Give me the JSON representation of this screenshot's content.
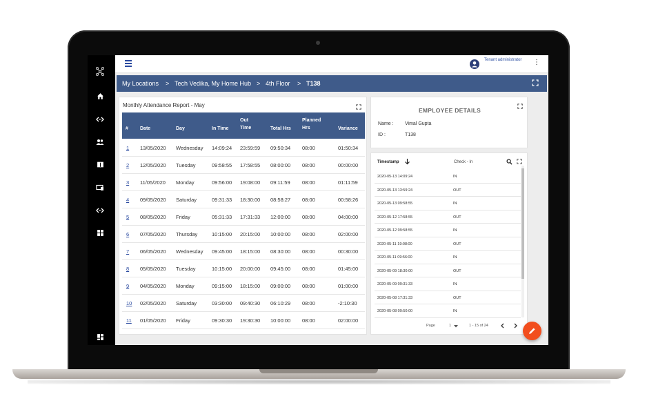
{
  "topbar": {
    "user_role": "Tenant administrator"
  },
  "breadcrumb": {
    "items": [
      "My Locations",
      ">",
      "Tech Vedika, My Home Hub",
      ">",
      "4th Floor",
      ">",
      "T138"
    ]
  },
  "attendance": {
    "title": "Monthly Attendance Report - May",
    "headers": [
      "#",
      "Date",
      "Day",
      "In Time",
      "Out Time",
      "Total Hrs",
      "Planned Hrs",
      "Variance"
    ],
    "rows": [
      [
        "1",
        "13/05/2020",
        "Wednesday",
        "14:09:24",
        "23:59:59",
        "09:50:34",
        "08:00",
        "01:50:34"
      ],
      [
        "2",
        "12/05/2020",
        "Tuesday",
        "09:58:55",
        "17:58:55",
        "08:00:00",
        "08:00",
        "00:00:00"
      ],
      [
        "3",
        "11/05/2020",
        "Monday",
        "09:56:00",
        "19:08:00",
        "09:11:59",
        "08:00",
        "01:11:59"
      ],
      [
        "4",
        "09/05/2020",
        "Saturday",
        "09:31:33",
        "18:30:00",
        "08:58:27",
        "08:00",
        "00:58:26"
      ],
      [
        "5",
        "08/05/2020",
        "Friday",
        "05:31:33",
        "17:31:33",
        "12:00:00",
        "08:00",
        "04:00:00"
      ],
      [
        "6",
        "07/05/2020",
        "Thursday",
        "10:15:00",
        "20:15:00",
        "10:00:00",
        "08:00",
        "02:00:00"
      ],
      [
        "7",
        "06/05/2020",
        "Wednesday",
        "09:45:00",
        "18:15:00",
        "08:30:00",
        "08:00",
        "00:30:00"
      ],
      [
        "8",
        "05/05/2020",
        "Tuesday",
        "10:15:00",
        "20:00:00",
        "09:45:00",
        "08:00",
        "01:45:00"
      ],
      [
        "9",
        "04/05/2020",
        "Monday",
        "09:15:00",
        "18:15:00",
        "09:00:00",
        "08:00",
        "01:00:00"
      ],
      [
        "10",
        "02/05/2020",
        "Saturday",
        "03:30:00",
        "09:40:30",
        "06:10:29",
        "08:00",
        "-2:10:30"
      ],
      [
        "11",
        "01/05/2020",
        "Friday",
        "09:30:30",
        "19:30:30",
        "10:00:00",
        "08:00",
        "02:00:00"
      ]
    ]
  },
  "employee": {
    "title": "EMPLOYEE DETAILS",
    "name_label": "Name :",
    "name": "Vimal Gupta",
    "id_label": "ID :",
    "id": "T138"
  },
  "timestamps": {
    "col_timestamp": "Timestamp",
    "col_check": "Check - In",
    "rows": [
      [
        "2020-05-13 14:09:24",
        "IN"
      ],
      [
        "2020-05-13 13:59:24",
        "OUT"
      ],
      [
        "2020-05-13 09:58:55",
        "IN"
      ],
      [
        "2020-05-12 17:58:55",
        "OUT"
      ],
      [
        "2020-05-12 09:58:55",
        "IN"
      ],
      [
        "2020-05-11 19:08:00",
        "OUT"
      ],
      [
        "2020-05-11 09:56:00",
        "IN"
      ],
      [
        "2020-05-09 18:30:00",
        "OUT"
      ],
      [
        "2020-05-09 09:31:33",
        "IN"
      ],
      [
        "2020-05-08 17:31:33",
        "OUT"
      ],
      [
        "2020-05-08 09:50:00",
        "IN"
      ]
    ],
    "page_label": "Page",
    "page_value": "1",
    "range": "1 - 15 of 24"
  },
  "colors": {
    "header_blue": "#3f5b8a",
    "fab_orange": "#f24e1e"
  }
}
